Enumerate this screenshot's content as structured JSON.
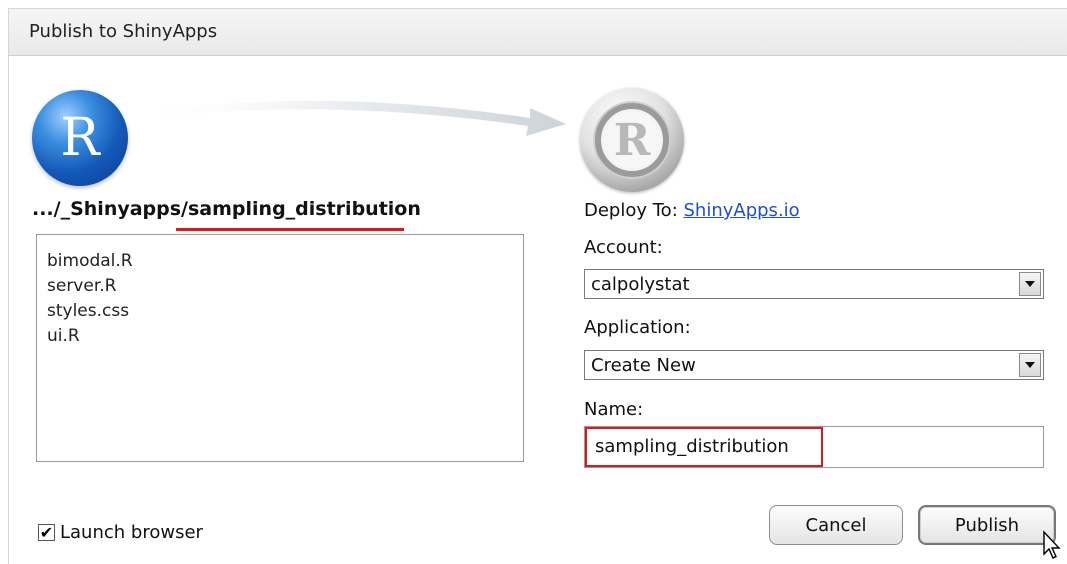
{
  "window": {
    "title": "Publish to ShinyApps"
  },
  "source": {
    "logo_letter": "R",
    "path_prefix": ".../_Shinyapps/",
    "path_folder": "sampling_distribution",
    "files": [
      "bimodal.R",
      "server.R",
      "styles.css",
      "ui.R"
    ]
  },
  "destination": {
    "logo_letter": "R",
    "deploy_to_label": "Deploy To:",
    "deploy_to_link": "ShinyApps.io"
  },
  "form": {
    "account_label": "Account:",
    "account_value": "calpolystat",
    "application_label": "Application:",
    "application_value": "Create New",
    "name_label": "Name:",
    "name_value": "sampling_distribution"
  },
  "options": {
    "launch_browser_label": "Launch browser",
    "launch_browser_checked": true
  },
  "buttons": {
    "cancel": "Cancel",
    "publish": "Publish"
  },
  "colors": {
    "highlight": "#d9191b",
    "link": "#1d4fd6",
    "source_logo": "#1359b8"
  }
}
